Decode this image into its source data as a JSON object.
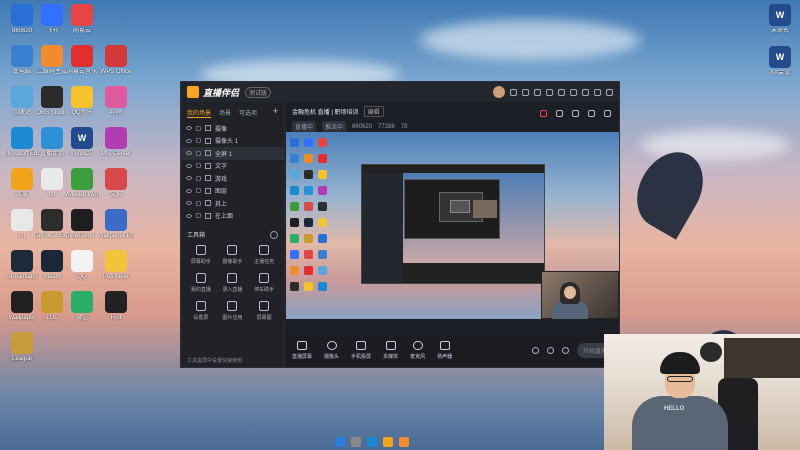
{
  "desktop_icons": [
    {
      "label": "860620",
      "color": "#2a6fd6",
      "glyph": ""
    },
    {
      "label": "飞书",
      "color": "#3370ff",
      "glyph": ""
    },
    {
      "label": "网易云",
      "color": "#e64545",
      "glyph": ""
    },
    {
      "label": "此电脑",
      "color": "#3b7fd1",
      "glyph": ""
    },
    {
      "label": "二维码生成",
      "color": "#f08c2e",
      "glyph": ""
    },
    {
      "label": "网易云音乐",
      "color": "#e12f2f",
      "glyph": ""
    },
    {
      "label": "WPS Office",
      "color": "#d23a3a",
      "glyph": ""
    },
    {
      "label": "回收站",
      "color": "#5aa7dc",
      "glyph": ""
    },
    {
      "label": "OBS Studio",
      "color": "#2b2b2b",
      "glyph": ""
    },
    {
      "label": "QQ音乐",
      "color": "#f3c22d",
      "glyph": ""
    },
    {
      "label": "哔哩",
      "color": "#e05aa0",
      "glyph": ""
    },
    {
      "label": "Microsoft Edge",
      "color": "#1b8ad2",
      "glyph": ""
    },
    {
      "label": "直播伴侣",
      "color": "#2d8fd6",
      "glyph": ""
    },
    {
      "label": "WinSCP",
      "color": "#234b8e",
      "glyph": "W"
    },
    {
      "label": "MSI Center",
      "color": "#b23db2",
      "glyph": ""
    },
    {
      "label": "风筝",
      "color": "#f3a31b",
      "glyph": ""
    },
    {
      "label": "txt",
      "color": "#e8e8e8",
      "glyph": ""
    },
    {
      "label": "VMware Workstation",
      "color": "#3c9d3c",
      "glyph": ""
    },
    {
      "label": "文档",
      "color": "#d84a4a",
      "glyph": ""
    },
    {
      "label": "txt",
      "color": "#e8e8e8",
      "glyph": ""
    },
    {
      "label": "GeForce Experience",
      "color": "#2d2d2d",
      "glyph": ""
    },
    {
      "label": "WeGame",
      "color": "#1f1f1f",
      "glyph": ""
    },
    {
      "label": "Wallpaper Engine",
      "color": "#3a6cc8",
      "glyph": ""
    },
    {
      "label": "Streamlabs",
      "color": "#1e2a3a",
      "glyph": ""
    },
    {
      "label": "Steam",
      "color": "#1b2838",
      "glyph": ""
    },
    {
      "label": "QQ",
      "color": "#f2f2f2",
      "glyph": ""
    },
    {
      "label": "PotPlayer",
      "color": "#f2c43a",
      "glyph": ""
    },
    {
      "label": "Wallpaper",
      "color": "#222",
      "glyph": ""
    },
    {
      "label": "LOL",
      "color": "#c99a2e",
      "glyph": ""
    },
    {
      "label": "微信",
      "color": "#2aae67",
      "glyph": ""
    },
    {
      "label": "Riot",
      "color": "#222",
      "glyph": ""
    },
    {
      "label": "League",
      "color": "#c89b3c",
      "glyph": ""
    }
  ],
  "right_icons": [
    {
      "label": "未命名",
      "color": "#234b8e",
      "glyph": "W"
    },
    {
      "label": "XX会议",
      "color": "#234b8e",
      "glyph": "W"
    }
  ],
  "app": {
    "title": "直播伴侣",
    "version": "测试版",
    "sidebar_tabs": [
      "我的场景",
      "场景",
      "可选项"
    ],
    "scenes": [
      "摄像",
      "摄像头 1",
      "全屏 1",
      "文字",
      "游戏",
      "图层",
      "其上",
      "在上面"
    ],
    "tools_heading": "工具箱",
    "tools": [
      "屏幕助手",
      "摄像助手",
      "主播任务",
      "我的直播",
      "录入直播",
      "停车助手",
      "设置屏",
      "图片应用",
      "屏幕图"
    ],
    "sidebar_footer": "工具盒屏中设置快速使用",
    "room_title": "金融危机  直播 | 职场培训",
    "room_edit": "编辑",
    "room_tag1": "直播中",
    "room_tag2": "推流中",
    "room_id": "860620",
    "likes": "77288",
    "viewers": "78",
    "toolbar": [
      "直播屏幕",
      "摄像头",
      "手机投屏",
      "多媒体",
      "麦克风",
      "扬声器"
    ],
    "start_label": "开始直播"
  },
  "webcam_shirt_text": "HELLO"
}
